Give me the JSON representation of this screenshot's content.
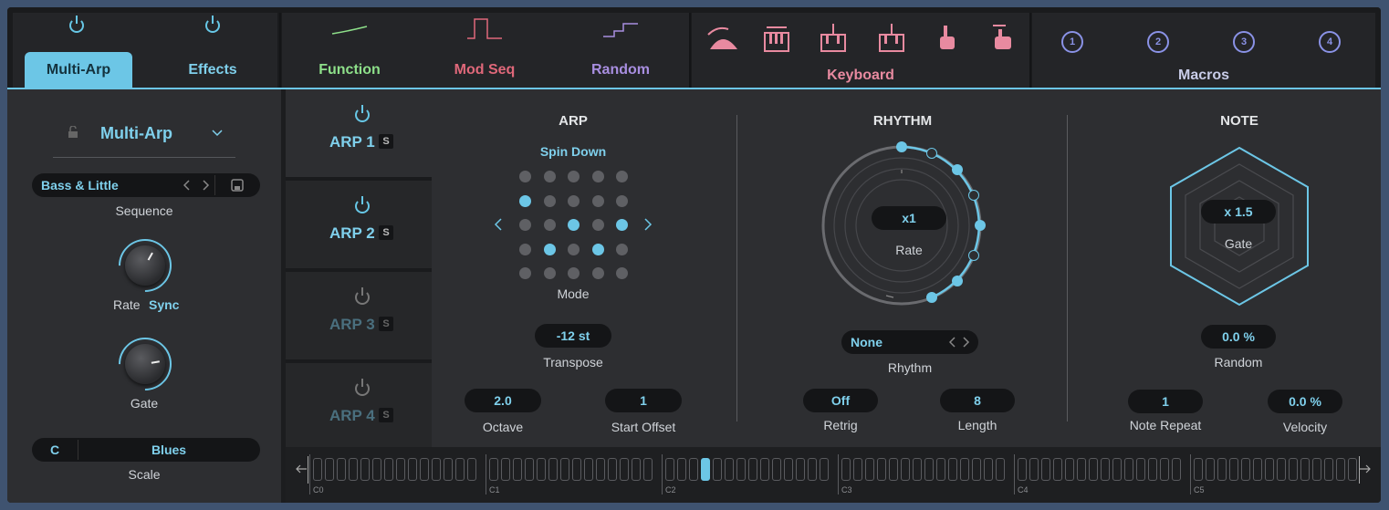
{
  "top_tabs": {
    "multi_arp": "Multi-Arp",
    "effects": "Effects",
    "function": "Function",
    "mod_seq": "Mod Seq",
    "random": "Random",
    "keyboard": "Keyboard",
    "macros": "Macros",
    "macro_numbers": [
      "1",
      "2",
      "3",
      "4"
    ]
  },
  "colors": {
    "accent": "#6cc6e6",
    "function": "#8ee08a",
    "mod_seq": "#e0687a",
    "random": "#a88ee0",
    "keyboard": "#e88aa0",
    "macros": "#8a92e6"
  },
  "left": {
    "preset_name": "Multi-Arp",
    "sequence_value": "Bass & Little",
    "sequence_label": "Sequence",
    "rate_label": "Rate",
    "sync_label": "Sync",
    "gate_label": "Gate",
    "scale_key": "C",
    "scale_type": "Blues",
    "scale_label": "Scale"
  },
  "arps": [
    {
      "name": "ARP 1",
      "solo": "S"
    },
    {
      "name": "ARP 2",
      "solo": "S"
    },
    {
      "name": "ARP 3",
      "solo": "S"
    },
    {
      "name": "ARP 4",
      "solo": "S"
    }
  ],
  "arp": {
    "title": "ARP",
    "pattern": "Spin Down",
    "mode_label": "Mode",
    "transpose_value": "-12 st",
    "transpose_label": "Transpose",
    "octave_value": "2.0",
    "octave_label": "Octave",
    "start_offset_value": "1",
    "start_offset_label": "Start Offset"
  },
  "rhythm": {
    "title": "RHYTHM",
    "rate_value": "x1",
    "rate_label": "Rate",
    "rhythm_value": "None",
    "rhythm_label": "Rhythm",
    "retrig_value": "Off",
    "retrig_label": "Retrig",
    "length_value": "8",
    "length_label": "Length"
  },
  "note": {
    "title": "NOTE",
    "gate_value": "x 1.5",
    "gate_label": "Gate",
    "random_value": "0.0 %",
    "random_label": "Random",
    "note_repeat_value": "1",
    "note_repeat_label": "Note Repeat",
    "velocity_value": "0.0 %",
    "velocity_label": "Velocity"
  },
  "keyboard_strip": {
    "octaves": [
      "C0",
      "C1",
      "C2",
      "C3",
      "C4",
      "C5"
    ],
    "active_key": "D2"
  }
}
